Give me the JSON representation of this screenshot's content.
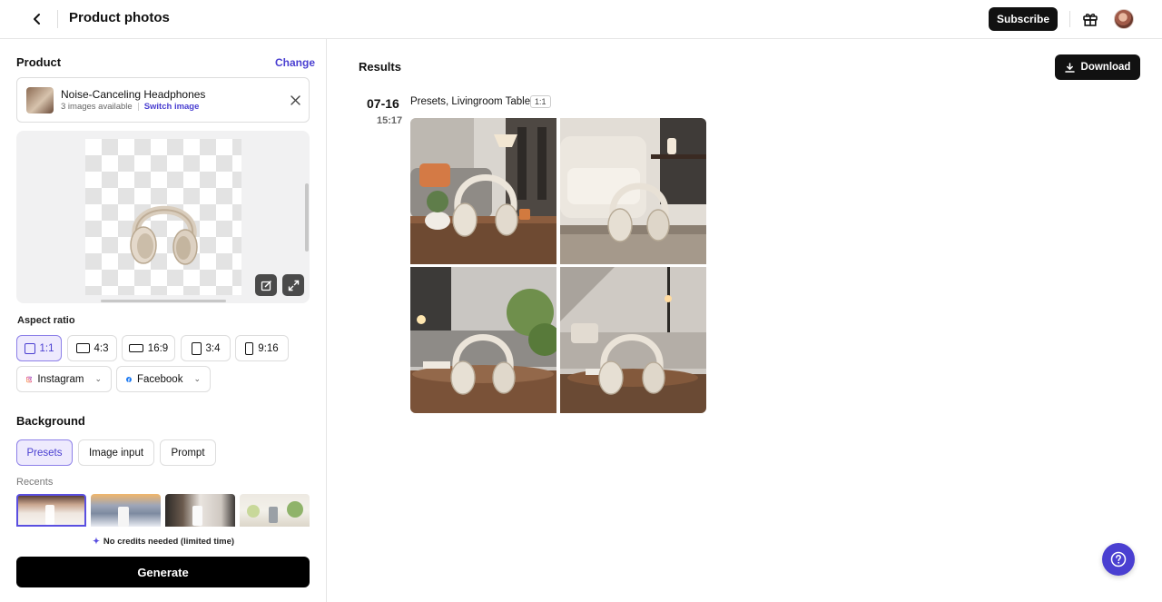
{
  "header": {
    "title": "Product photos",
    "subscribe_label": "Subscribe"
  },
  "product": {
    "section_title": "Product",
    "change_label": "Change",
    "name": "Noise-Canceling Headphones",
    "images_available": "3 images available",
    "switch_label": "Switch image"
  },
  "aspect": {
    "label": "Aspect ratio",
    "options": [
      "1:1",
      "4:3",
      "16:9",
      "3:4",
      "9:16"
    ],
    "selected": "1:1",
    "social": [
      "Instagram",
      "Facebook"
    ]
  },
  "background": {
    "title": "Background",
    "tabs": [
      "Presets",
      "Image input",
      "Prompt"
    ],
    "active_tab": "Presets",
    "recents_label": "Recents"
  },
  "credits_text": "No credits needed (limited time)",
  "generate_label": "Generate",
  "results": {
    "title": "Results",
    "download_label": "Download",
    "date": "07-16",
    "time": "15:17",
    "label": "Presets, Livingroom Table",
    "ratio": "1:1"
  },
  "colors": {
    "accent": "#4a3fd1",
    "accent_bg": "#eeeafd",
    "primary_button": "#000000"
  }
}
